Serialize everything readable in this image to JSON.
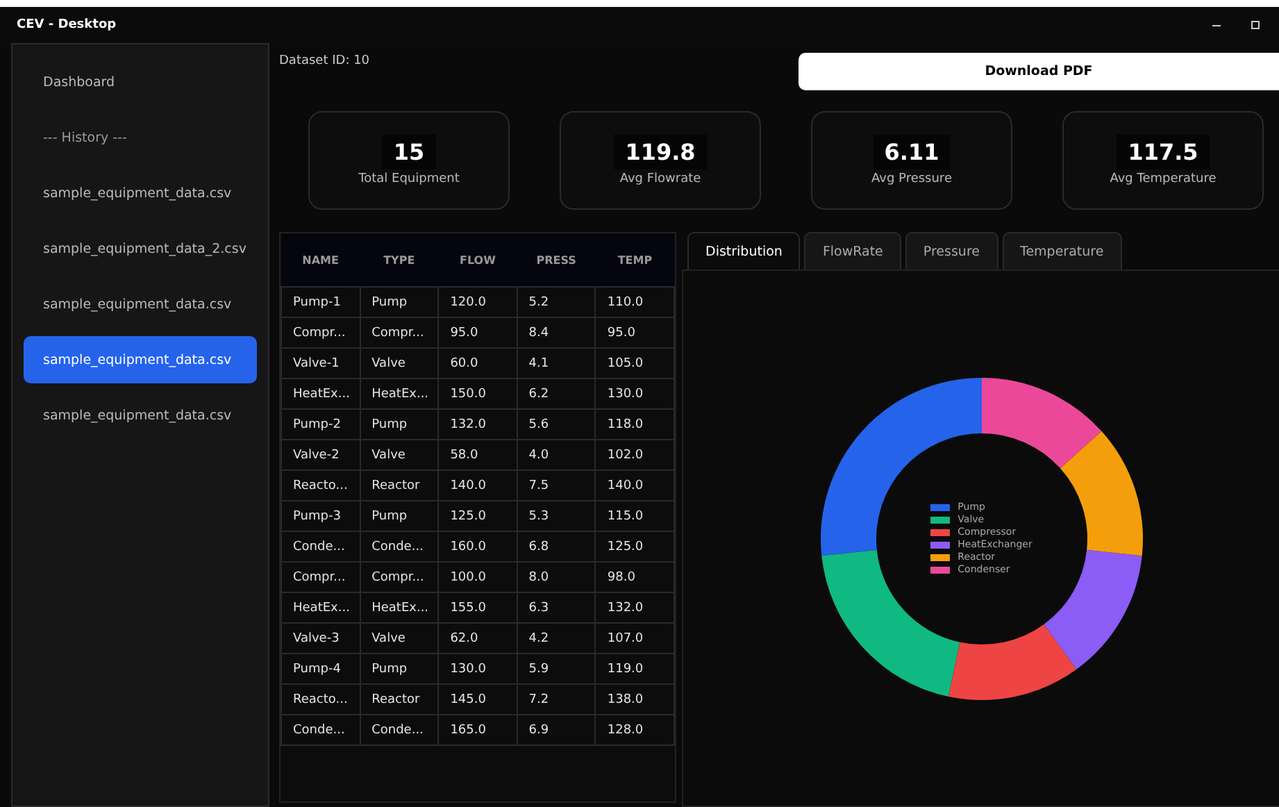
{
  "window": {
    "title": "CEV - Desktop"
  },
  "sidebar": {
    "items": [
      {
        "label": "Dashboard",
        "kind": "link",
        "selected": false
      },
      {
        "label": "--- History ---",
        "kind": "heading",
        "selected": false
      },
      {
        "label": "sample_equipment_data.csv",
        "kind": "link",
        "selected": false
      },
      {
        "label": "sample_equipment_data_2.csv",
        "kind": "link",
        "selected": false
      },
      {
        "label": "sample_equipment_data.csv",
        "kind": "link",
        "selected": false
      },
      {
        "label": "sample_equipment_data.csv",
        "kind": "link",
        "selected": true
      },
      {
        "label": "sample_equipment_data.csv",
        "kind": "link",
        "selected": false
      }
    ]
  },
  "dataset_id": "Dataset ID: 10",
  "download_button": "Download PDF",
  "stats": [
    {
      "value": "15",
      "label": "Total Equipment"
    },
    {
      "value": "119.8",
      "label": "Avg Flowrate"
    },
    {
      "value": "6.11",
      "label": "Avg Pressure"
    },
    {
      "value": "117.5",
      "label": "Avg Temperature"
    }
  ],
  "table": {
    "columns": [
      "NAME",
      "TYPE",
      "FLOW",
      "PRESS",
      "TEMP"
    ],
    "rows": [
      [
        "Pump-1",
        "Pump",
        "120.0",
        "5.2",
        "110.0"
      ],
      [
        "Compr...",
        "Compr...",
        "95.0",
        "8.4",
        "95.0"
      ],
      [
        "Valve-1",
        "Valve",
        "60.0",
        "4.1",
        "105.0"
      ],
      [
        "HeatEx...",
        "HeatEx...",
        "150.0",
        "6.2",
        "130.0"
      ],
      [
        "Pump-2",
        "Pump",
        "132.0",
        "5.6",
        "118.0"
      ],
      [
        "Valve-2",
        "Valve",
        "58.0",
        "4.0",
        "102.0"
      ],
      [
        "Reacto...",
        "Reactor",
        "140.0",
        "7.5",
        "140.0"
      ],
      [
        "Pump-3",
        "Pump",
        "125.0",
        "5.3",
        "115.0"
      ],
      [
        "Conde...",
        "Conde...",
        "160.0",
        "6.8",
        "125.0"
      ],
      [
        "Compr...",
        "Compr...",
        "100.0",
        "8.0",
        "98.0"
      ],
      [
        "HeatEx...",
        "HeatEx...",
        "155.0",
        "6.3",
        "132.0"
      ],
      [
        "Valve-3",
        "Valve",
        "62.0",
        "4.2",
        "107.0"
      ],
      [
        "Pump-4",
        "Pump",
        "130.0",
        "5.9",
        "119.0"
      ],
      [
        "Reacto...",
        "Reactor",
        "145.0",
        "7.2",
        "138.0"
      ],
      [
        "Conde...",
        "Conde...",
        "165.0",
        "6.9",
        "128.0"
      ]
    ]
  },
  "tabs": [
    {
      "label": "Distribution",
      "selected": true
    },
    {
      "label": "FlowRate",
      "selected": false
    },
    {
      "label": "Pressure",
      "selected": false
    },
    {
      "label": "Temperature",
      "selected": false
    }
  ],
  "chart": {
    "chart_data": {
      "type": "donut",
      "categories": [
        "Pump",
        "Valve",
        "Compressor",
        "HeatExchanger",
        "Reactor",
        "Condenser"
      ],
      "values": [
        26.67,
        20,
        13.33,
        13.33,
        13.33,
        13.33
      ],
      "colors": [
        "#2563eb",
        "#10b981",
        "#ef4444",
        "#8b5cf6",
        "#f59e0b",
        "#ec4899"
      ]
    }
  }
}
